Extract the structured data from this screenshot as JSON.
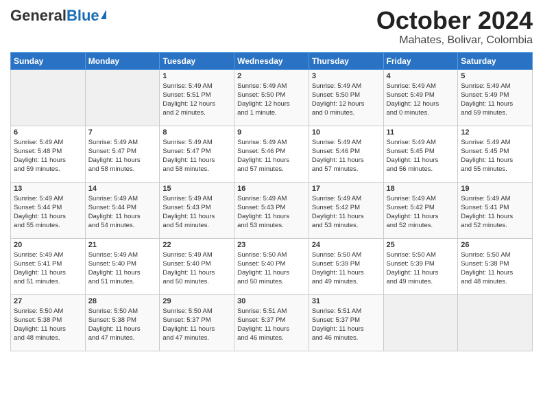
{
  "header": {
    "logo_general": "General",
    "logo_blue": "Blue",
    "month_title": "October 2024",
    "location": "Mahates, Bolivar, Colombia"
  },
  "days_of_week": [
    "Sunday",
    "Monday",
    "Tuesday",
    "Wednesday",
    "Thursday",
    "Friday",
    "Saturday"
  ],
  "weeks": [
    [
      {
        "day": "",
        "info": ""
      },
      {
        "day": "",
        "info": ""
      },
      {
        "day": "1",
        "info": "Sunrise: 5:49 AM\nSunset: 5:51 PM\nDaylight: 12 hours\nand 2 minutes."
      },
      {
        "day": "2",
        "info": "Sunrise: 5:49 AM\nSunset: 5:50 PM\nDaylight: 12 hours\nand 1 minute."
      },
      {
        "day": "3",
        "info": "Sunrise: 5:49 AM\nSunset: 5:50 PM\nDaylight: 12 hours\nand 0 minutes."
      },
      {
        "day": "4",
        "info": "Sunrise: 5:49 AM\nSunset: 5:49 PM\nDaylight: 12 hours\nand 0 minutes."
      },
      {
        "day": "5",
        "info": "Sunrise: 5:49 AM\nSunset: 5:49 PM\nDaylight: 11 hours\nand 59 minutes."
      }
    ],
    [
      {
        "day": "6",
        "info": "Sunrise: 5:49 AM\nSunset: 5:48 PM\nDaylight: 11 hours\nand 59 minutes."
      },
      {
        "day": "7",
        "info": "Sunrise: 5:49 AM\nSunset: 5:47 PM\nDaylight: 11 hours\nand 58 minutes."
      },
      {
        "day": "8",
        "info": "Sunrise: 5:49 AM\nSunset: 5:47 PM\nDaylight: 11 hours\nand 58 minutes."
      },
      {
        "day": "9",
        "info": "Sunrise: 5:49 AM\nSunset: 5:46 PM\nDaylight: 11 hours\nand 57 minutes."
      },
      {
        "day": "10",
        "info": "Sunrise: 5:49 AM\nSunset: 5:46 PM\nDaylight: 11 hours\nand 57 minutes."
      },
      {
        "day": "11",
        "info": "Sunrise: 5:49 AM\nSunset: 5:45 PM\nDaylight: 11 hours\nand 56 minutes."
      },
      {
        "day": "12",
        "info": "Sunrise: 5:49 AM\nSunset: 5:45 PM\nDaylight: 11 hours\nand 55 minutes."
      }
    ],
    [
      {
        "day": "13",
        "info": "Sunrise: 5:49 AM\nSunset: 5:44 PM\nDaylight: 11 hours\nand 55 minutes."
      },
      {
        "day": "14",
        "info": "Sunrise: 5:49 AM\nSunset: 5:44 PM\nDaylight: 11 hours\nand 54 minutes."
      },
      {
        "day": "15",
        "info": "Sunrise: 5:49 AM\nSunset: 5:43 PM\nDaylight: 11 hours\nand 54 minutes."
      },
      {
        "day": "16",
        "info": "Sunrise: 5:49 AM\nSunset: 5:43 PM\nDaylight: 11 hours\nand 53 minutes."
      },
      {
        "day": "17",
        "info": "Sunrise: 5:49 AM\nSunset: 5:42 PM\nDaylight: 11 hours\nand 53 minutes."
      },
      {
        "day": "18",
        "info": "Sunrise: 5:49 AM\nSunset: 5:42 PM\nDaylight: 11 hours\nand 52 minutes."
      },
      {
        "day": "19",
        "info": "Sunrise: 5:49 AM\nSunset: 5:41 PM\nDaylight: 11 hours\nand 52 minutes."
      }
    ],
    [
      {
        "day": "20",
        "info": "Sunrise: 5:49 AM\nSunset: 5:41 PM\nDaylight: 11 hours\nand 51 minutes."
      },
      {
        "day": "21",
        "info": "Sunrise: 5:49 AM\nSunset: 5:40 PM\nDaylight: 11 hours\nand 51 minutes."
      },
      {
        "day": "22",
        "info": "Sunrise: 5:49 AM\nSunset: 5:40 PM\nDaylight: 11 hours\nand 50 minutes."
      },
      {
        "day": "23",
        "info": "Sunrise: 5:50 AM\nSunset: 5:40 PM\nDaylight: 11 hours\nand 50 minutes."
      },
      {
        "day": "24",
        "info": "Sunrise: 5:50 AM\nSunset: 5:39 PM\nDaylight: 11 hours\nand 49 minutes."
      },
      {
        "day": "25",
        "info": "Sunrise: 5:50 AM\nSunset: 5:39 PM\nDaylight: 11 hours\nand 49 minutes."
      },
      {
        "day": "26",
        "info": "Sunrise: 5:50 AM\nSunset: 5:38 PM\nDaylight: 11 hours\nand 48 minutes."
      }
    ],
    [
      {
        "day": "27",
        "info": "Sunrise: 5:50 AM\nSunset: 5:38 PM\nDaylight: 11 hours\nand 48 minutes."
      },
      {
        "day": "28",
        "info": "Sunrise: 5:50 AM\nSunset: 5:38 PM\nDaylight: 11 hours\nand 47 minutes."
      },
      {
        "day": "29",
        "info": "Sunrise: 5:50 AM\nSunset: 5:37 PM\nDaylight: 11 hours\nand 47 minutes."
      },
      {
        "day": "30",
        "info": "Sunrise: 5:51 AM\nSunset: 5:37 PM\nDaylight: 11 hours\nand 46 minutes."
      },
      {
        "day": "31",
        "info": "Sunrise: 5:51 AM\nSunset: 5:37 PM\nDaylight: 11 hours\nand 46 minutes."
      },
      {
        "day": "",
        "info": ""
      },
      {
        "day": "",
        "info": ""
      }
    ]
  ]
}
